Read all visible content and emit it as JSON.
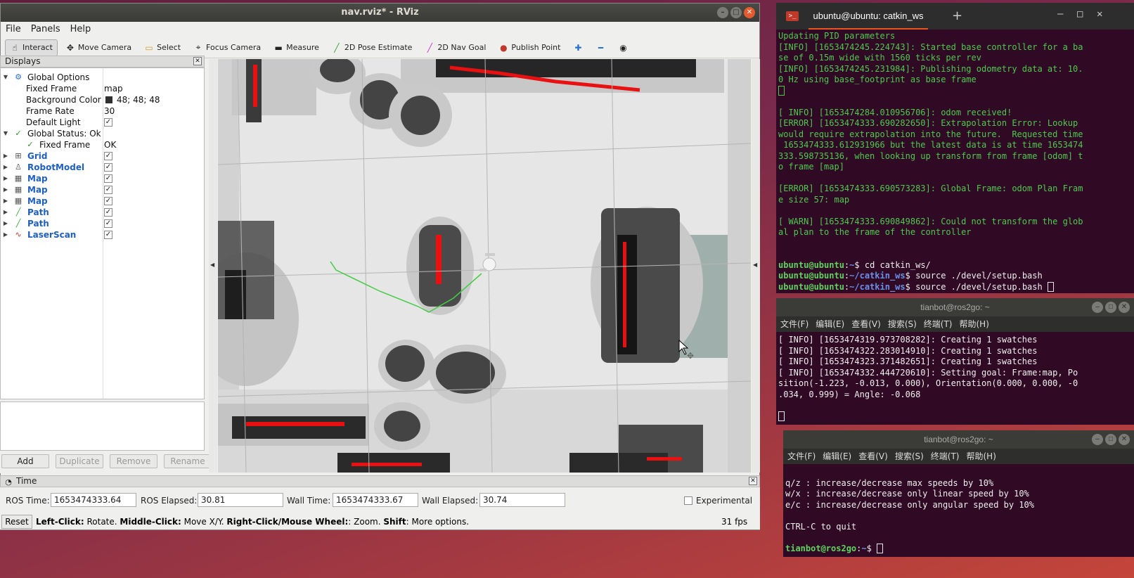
{
  "rviz": {
    "title": "nav.rviz* - RViz",
    "menu": [
      "File",
      "Panels",
      "Help"
    ],
    "toolbar": {
      "interact": "Interact",
      "move_camera": "Move Camera",
      "select": "Select",
      "focus_camera": "Focus Camera",
      "measure": "Measure",
      "pose_estimate": "2D Pose Estimate",
      "nav_goal": "2D Nav Goal",
      "publish_point": "Publish Point"
    },
    "displays": {
      "title": "Displays",
      "global_options": "Global Options",
      "fixed_frame_label": "Fixed Frame",
      "fixed_frame_value": "map",
      "bg_color_label": "Background Color",
      "bg_color_value": "48; 48; 48",
      "frame_rate_label": "Frame Rate",
      "frame_rate_value": "30",
      "default_light_label": "Default Light",
      "global_status": "Global Status: Ok",
      "status_fixed_frame": "Fixed Frame",
      "status_fixed_frame_value": "OK",
      "items": [
        "Grid",
        "RobotModel",
        "Map",
        "Map",
        "Map",
        "Path",
        "Path",
        "LaserScan"
      ],
      "buttons": {
        "add": "Add",
        "duplicate": "Duplicate",
        "remove": "Remove",
        "rename": "Rename"
      }
    },
    "time": {
      "title": "Time",
      "ros_time_label": "ROS Time:",
      "ros_time": "1653474333.64",
      "ros_elapsed_label": "ROS Elapsed:",
      "ros_elapsed": "30.81",
      "wall_time_label": "Wall Time:",
      "wall_time": "1653474333.67",
      "wall_elapsed_label": "Wall Elapsed:",
      "wall_elapsed": "30.74",
      "experimental": "Experimental"
    },
    "status": {
      "reset": "Reset",
      "left_click": "Left-Click:",
      "left_click_desc": " Rotate. ",
      "middle_click": "Middle-Click:",
      "middle_click_desc": " Move X/Y. ",
      "right_click": "Right-Click/Mouse Wheel:",
      "right_click_desc": ": Zoom. ",
      "shift": "Shift",
      "shift_desc": ": More options.",
      "fps": "31 fps"
    },
    "colors": {
      "map_free": "#dadada",
      "obstacle": "#232323",
      "inflation": "#5a5a5a",
      "laser": "#e81010",
      "path": "#44cc44"
    }
  },
  "term1": {
    "tab": "ubuntu@ubuntu: catkin_ws",
    "lines": [
      "Updating PID parameters",
      "[INFO] [1653474245.224743]: Started base controller for a ba",
      "se of 0.15m wide with 1560 ticks per rev",
      "[INFO] [1653474245.231984]: Publishing odometry data at: 10.",
      "0 Hz using base_footprint as base frame",
      "",
      "",
      "[ INFO] [1653474284.010956706]: odom received!",
      "[ERROR] [1653474333.690282650]: Extrapolation Error: Lookup",
      "would require extrapolation into the future.  Requested time",
      " 1653474333.612931966 but the latest data is at time 1653474",
      "333.598735136, when looking up transform from frame [odom] t",
      "o frame [map]",
      "",
      "[ERROR] [1653474333.690573283]: Global Frame: odom Plan Fram",
      "e size 57: map",
      "",
      "[ WARN] [1653474333.690849862]: Could not transform the glob",
      "al plan to the frame of the controller",
      "",
      ""
    ],
    "prompt_user": "ubuntu@ubuntu",
    "cmd1_path": "~",
    "cmd1": " cd catkin_ws/",
    "cmd2_path": "~/catkin_ws",
    "cmd2": " source ./devel/setup.bash",
    "cmd3_path": "~/catkin_ws",
    "cmd3": " source ./devel/setup.bash"
  },
  "term2": {
    "title": "tianbot@ros2go: ~",
    "menu": [
      "文件(F)",
      "编辑(E)",
      "查看(V)",
      "搜索(S)",
      "终端(T)",
      "帮助(H)"
    ],
    "lines": [
      "[ INFO] [1653474319.973708282]: Creating 1 swatches",
      "[ INFO] [1653474322.283014910]: Creating 1 swatches",
      "[ INFO] [1653474323.371482651]: Creating 1 swatches",
      "[ INFO] [1653474332.444720610]: Setting goal: Frame:map, Po",
      "sition(-1.223, -0.013, 0.000), Orientation(0.000, 0.000, -0",
      ".034, 0.999) = Angle: -0.068",
      ""
    ]
  },
  "term3": {
    "title": "tianbot@ros2go: ~",
    "menu": [
      "文件(F)",
      "编辑(E)",
      "查看(V)",
      "搜索(S)",
      "终端(T)",
      "帮助(H)"
    ],
    "lines": [
      "",
      "q/z : increase/decrease max speeds by 10%",
      "w/x : increase/decrease only linear speed by 10%",
      "e/c : increase/decrease only angular speed by 10%",
      "",
      "CTRL-C to quit",
      ""
    ],
    "prompt_user": "tianbot@ros2go",
    "prompt_path": "~"
  }
}
